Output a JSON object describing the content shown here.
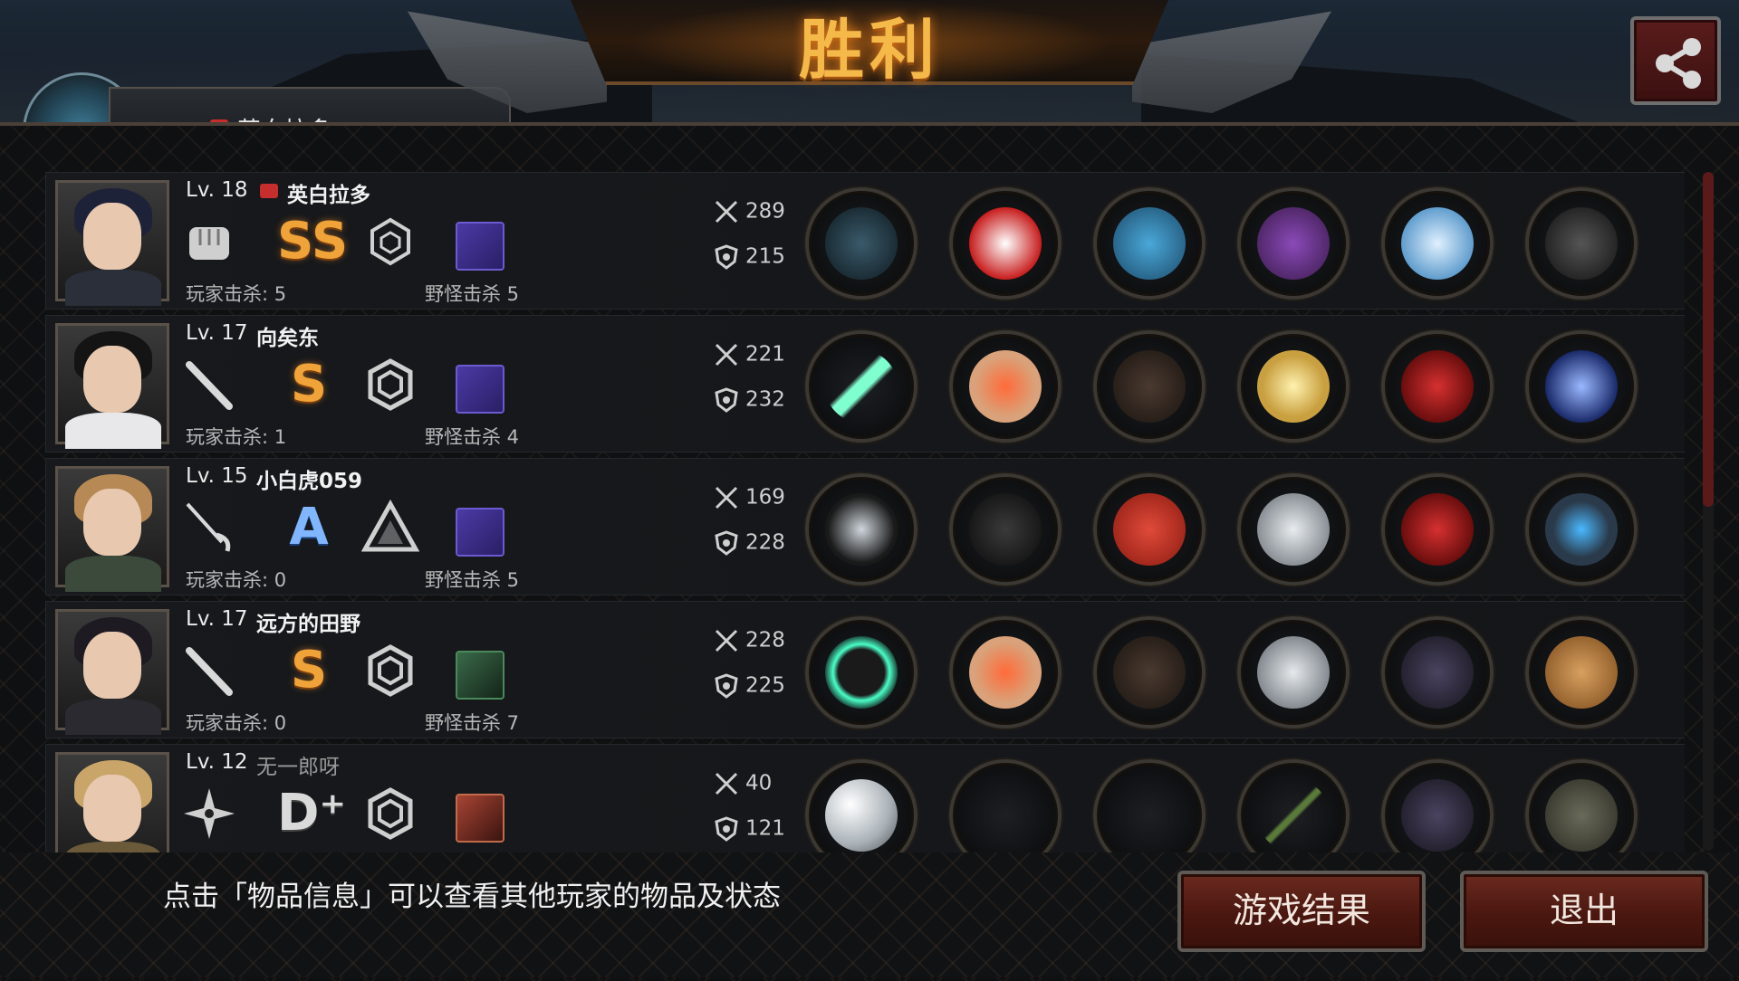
{
  "title": "胜利",
  "top_partial_name": "英白拉多",
  "hint": "点击「物品信息」可以查看其他玩家的物品及状态",
  "buttons": {
    "results": "游戏结果",
    "exit": "退出"
  },
  "players": [
    {
      "level": "Lv. 18",
      "name": "英白拉多",
      "flag": true,
      "weapon_icon": "fist-icon",
      "grade": "SS",
      "trait_icon": "hexagon-trait-icon",
      "player_kills": "玩家击杀: 5",
      "monster_kills": "野怪击杀 5",
      "attack": "289",
      "defense": "215",
      "items": [
        "claw-gauntlet",
        "motocross-helmet",
        "blue-armor",
        "purple-gauntlet",
        "blue-sneakers",
        "black-flag"
      ]
    },
    {
      "level": "Lv. 17",
      "name": "向矣东",
      "flag": false,
      "weapon_icon": "bat-icon",
      "grade": "S",
      "trait_icon": "gear-trait-icon",
      "player_kills": "玩家击杀: 1",
      "monster_kills": "野怪击杀 4",
      "attack": "221",
      "defense": "232",
      "items": [
        "twin-lightsabers",
        "winged-tiara",
        "leather-jacket",
        "gold-bracelet",
        "red-heels",
        "galaxy-orb"
      ]
    },
    {
      "level": "Lv. 15",
      "name": "小白虎059",
      "flag": false,
      "weapon_icon": "rapier-icon",
      "grade": "A",
      "trait_icon": "triangle-trait-icon",
      "player_kills": "玩家击杀: 0",
      "monster_kills": "野怪击杀 5",
      "attack": "169",
      "defense": "228",
      "items": [
        "crossed-blades",
        "tactical-helmet",
        "red-dress",
        "silver-vambrace",
        "red-heels",
        "blue-gem-ring"
      ]
    },
    {
      "level": "Lv. 17",
      "name": "远方的田野",
      "flag": false,
      "weapon_icon": "bat-icon",
      "grade": "S",
      "trait_icon": "gear-trait-icon",
      "player_kills": "玩家击杀: 0",
      "monster_kills": "野怪击杀 7",
      "attack": "228",
      "defense": "225",
      "items": [
        "thorn-wreath",
        "winged-tiara",
        "leather-jacket",
        "metal-disc",
        "dark-boots",
        "cat-box"
      ]
    },
    {
      "level": "Lv. 12",
      "name": "无一郎呀",
      "flag": false,
      "weapon_icon": "shuriken-icon",
      "grade": "D⁺",
      "trait_icon": "gear-trait-icon",
      "player_kills": "",
      "monster_kills": "",
      "attack": "40",
      "defense": "121",
      "items": [
        "crystal-ball",
        "",
        "",
        "bamboo-stick",
        "dark-boots",
        "camo-armor"
      ]
    }
  ]
}
